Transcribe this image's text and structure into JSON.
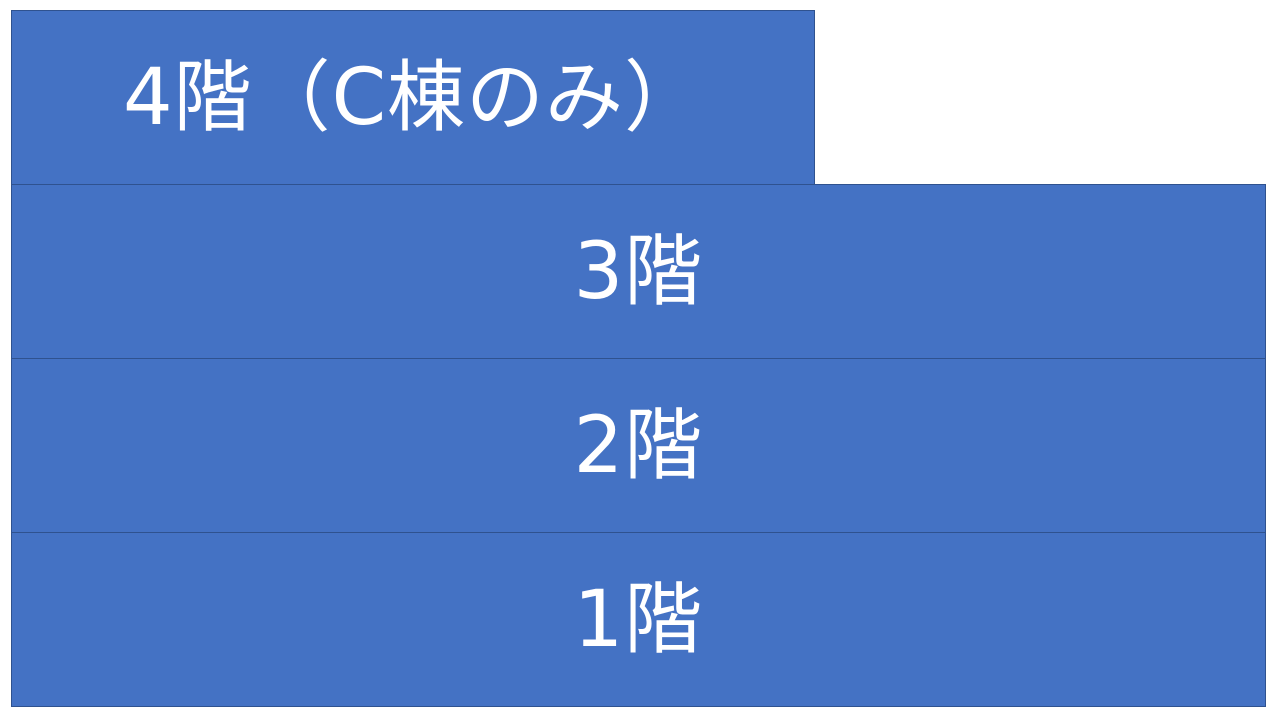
{
  "colors": {
    "block_fill": "#4472c4",
    "block_border": "#2f528f",
    "text": "#ffffff"
  },
  "floors": [
    {
      "label": "4階（C棟のみ）"
    },
    {
      "label": "3階"
    },
    {
      "label": "2階"
    },
    {
      "label": "1階"
    }
  ]
}
